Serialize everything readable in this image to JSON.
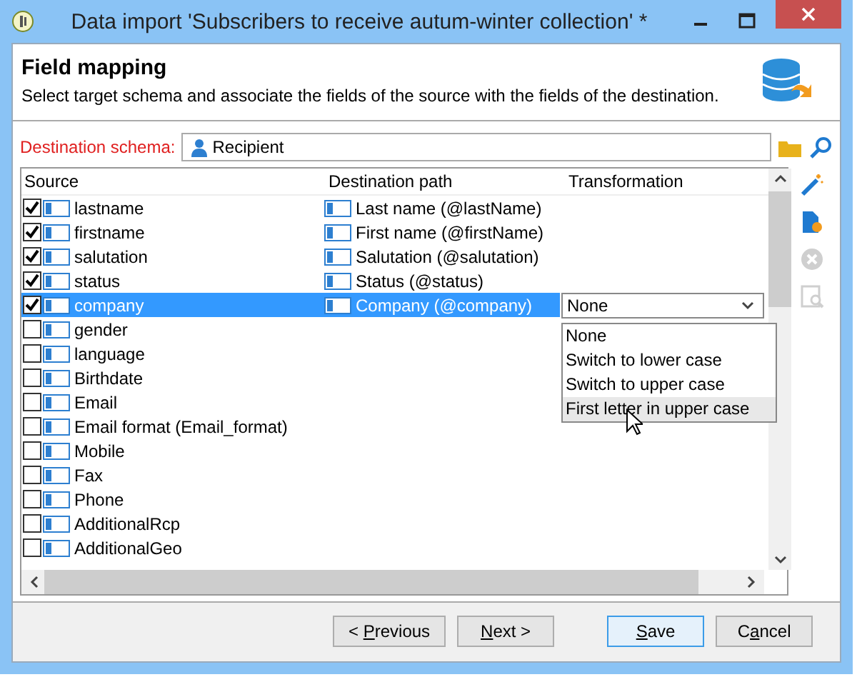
{
  "window": {
    "title": "Data import 'Subscribers to receive autum-winter collection' *"
  },
  "header": {
    "title": "Field mapping",
    "description": "Select target schema and associate the fields of the source with the fields of the destination."
  },
  "destination_schema": {
    "label": "Destination schema:",
    "value": "Recipient"
  },
  "table": {
    "columns": [
      "Source",
      "Destination path",
      "Transformation"
    ],
    "rows": [
      {
        "source": "lastname",
        "checked": true,
        "destination": "Last name (@lastName)",
        "selected": false
      },
      {
        "source": "firstname",
        "checked": true,
        "destination": "First name (@firstName)",
        "selected": false
      },
      {
        "source": "salutation",
        "checked": true,
        "destination": "Salutation (@salutation)",
        "selected": false
      },
      {
        "source": "status",
        "checked": true,
        "destination": "Status (@status)",
        "selected": false
      },
      {
        "source": "company",
        "checked": true,
        "destination": "Company (@company)",
        "transformation": "None",
        "selected": true
      },
      {
        "source": "gender",
        "checked": false,
        "selected": false
      },
      {
        "source": "language",
        "checked": false,
        "selected": false
      },
      {
        "source": "Birthdate",
        "checked": false,
        "selected": false
      },
      {
        "source": "Email",
        "checked": false,
        "selected": false
      },
      {
        "source": "Email format (Email_format)",
        "checked": false,
        "selected": false
      },
      {
        "source": "Mobile",
        "checked": false,
        "selected": false
      },
      {
        "source": "Fax",
        "checked": false,
        "selected": false
      },
      {
        "source": "Phone",
        "checked": false,
        "selected": false
      },
      {
        "source": "AdditionalRcp",
        "checked": false,
        "selected": false
      },
      {
        "source": "AdditionalGeo",
        "checked": false,
        "selected": false
      }
    ]
  },
  "dropdown": {
    "options": [
      {
        "label": "None",
        "highlighted": false
      },
      {
        "label": "Switch to lower case",
        "highlighted": false
      },
      {
        "label": "Switch to upper case",
        "highlighted": false
      },
      {
        "label": "First letter in upper case",
        "highlighted": true
      }
    ]
  },
  "toolbar": [
    {
      "kind": "wand",
      "disabled": false
    },
    {
      "kind": "add",
      "disabled": false
    },
    {
      "kind": "remove",
      "disabled": true
    },
    {
      "kind": "preview",
      "disabled": true
    }
  ],
  "buttons": [
    {
      "before": "< ",
      "key": "P",
      "after": "revious",
      "default": false
    },
    {
      "key": "N",
      "after": "ext >",
      "default": false
    },
    {
      "key": "S",
      "after": "ave",
      "default": true
    },
    {
      "before": "C",
      "key": "a",
      "after": "ncel",
      "default": false
    }
  ]
}
